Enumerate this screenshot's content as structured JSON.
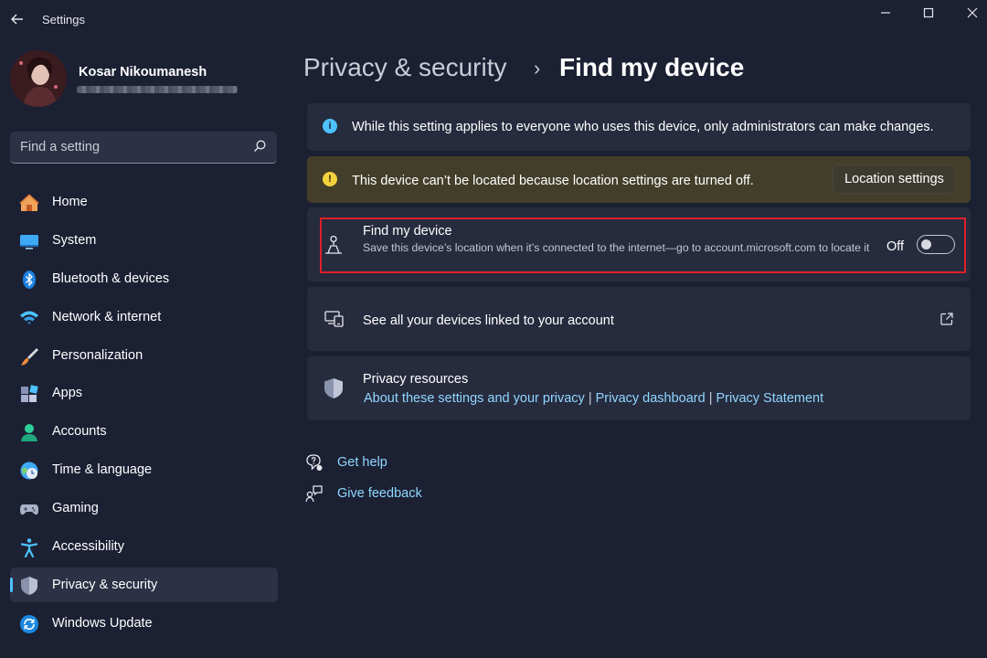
{
  "window": {
    "app_title": "Settings",
    "back_icon": "back-arrow-icon",
    "controls": {
      "minimize": "—",
      "maximize": "☐",
      "close": "✕"
    }
  },
  "profile": {
    "name": "Kosar Nikoumanesh"
  },
  "search": {
    "placeholder": "Find a setting"
  },
  "sidebar": {
    "items": [
      {
        "label": "Home",
        "icon": "home-icon"
      },
      {
        "label": "System",
        "icon": "system-icon"
      },
      {
        "label": "Bluetooth & devices",
        "icon": "bluetooth-icon"
      },
      {
        "label": "Network & internet",
        "icon": "wifi-icon"
      },
      {
        "label": "Personalization",
        "icon": "brush-icon"
      },
      {
        "label": "Apps",
        "icon": "apps-icon"
      },
      {
        "label": "Accounts",
        "icon": "accounts-icon"
      },
      {
        "label": "Time & language",
        "icon": "globe-clock-icon"
      },
      {
        "label": "Gaming",
        "icon": "gamepad-icon"
      },
      {
        "label": "Accessibility",
        "icon": "accessibility-icon"
      },
      {
        "label": "Privacy & security",
        "icon": "shield-icon",
        "active": true
      },
      {
        "label": "Windows Update",
        "icon": "update-icon"
      }
    ]
  },
  "header": {
    "parent": "Privacy & security",
    "separator": "›",
    "title": "Find my device"
  },
  "info_banner": {
    "icon_glyph": "i",
    "text": "While this setting applies to everyone who uses this device, only administrators can make changes."
  },
  "warning_banner": {
    "icon_glyph": "!",
    "text": "This device can’t be located because location settings are turned off.",
    "button_label": "Location settings"
  },
  "find_my_device": {
    "title": "Find my device",
    "description": "Save this device’s location when it’s connected to the internet—go to account.microsoft.com to locate it",
    "toggle_state": "Off",
    "toggle_on": false
  },
  "linked_devices": {
    "text": "See all your devices linked to your account"
  },
  "privacy_resources": {
    "title": "Privacy resources",
    "links": [
      "About these settings and your privacy",
      "Privacy dashboard",
      "Privacy Statement"
    ],
    "separator": "|"
  },
  "help": {
    "get_help": "Get help",
    "give_feedback": "Give feedback"
  },
  "colors": {
    "background": "#1c2033",
    "card": "#272b3e",
    "warning_card": "#433e2a",
    "accent": "#4cc2ff",
    "link": "#8fd8ff",
    "highlight": "#e01e2b"
  }
}
